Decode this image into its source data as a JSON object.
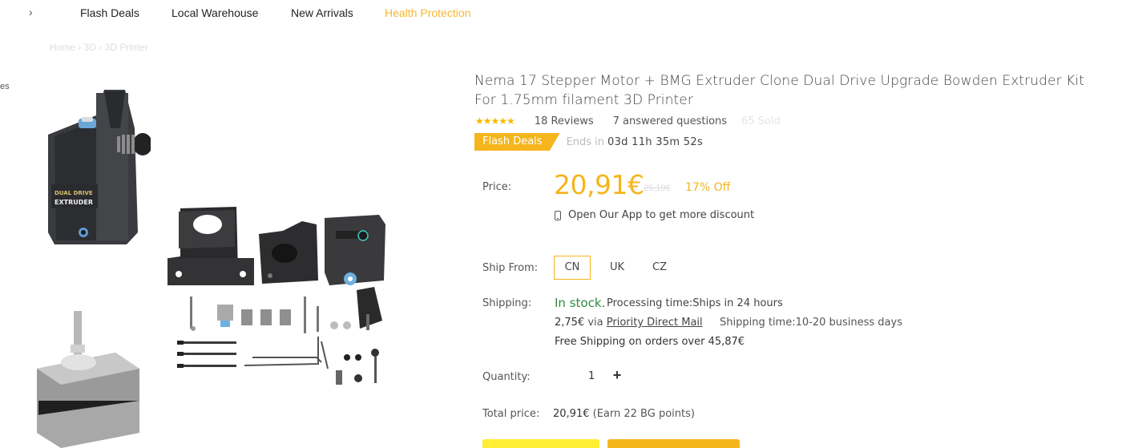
{
  "nav": {
    "chevron": "›",
    "items": [
      "Flash Deals",
      "Local Warehouse",
      "New Arrivals",
      "Health Protection"
    ]
  },
  "breadcrumb": "Home  ›  3D  ›  3D Printer",
  "side_fragment": "es",
  "product": {
    "title": "Nema 17 Stepper Motor + BMG Extruder Clone Dual Drive Upgrade Bowden Extruder Kit For 1.75mm filament 3D Printer",
    "stars": "★★★★★",
    "rating": 5,
    "reviews": "18 Reviews",
    "questions": "7 answered questions",
    "faded_meta": "65 Sold",
    "image_brand_line1": "DUAL DRIVE",
    "image_brand_line2": "EXTRUDER"
  },
  "flash": {
    "badge": "Flash Deals",
    "ends_label": "Ends in",
    "countdown": "03d 11h 35m 52s"
  },
  "price": {
    "label": "Price:",
    "current": "20,91€",
    "original": "25,19€",
    "discount": "17% Off",
    "app_promo": "Open Our App to get more discount"
  },
  "ship_from": {
    "label": "Ship From:",
    "options": [
      "CN",
      "UK",
      "CZ"
    ],
    "selected": "CN"
  },
  "shipping": {
    "label": "Shipping:",
    "stock": "In stock.",
    "processing": "Processing time:Ships in 24 hours",
    "cost": "2,75€",
    "via": "via",
    "method": "Priority Direct Mail",
    "ship_time": "Shipping time:10-20 business days",
    "free": "Free Shipping on orders over 45,87€"
  },
  "quantity": {
    "label": "Quantity:",
    "value": "1",
    "plus": "+"
  },
  "total": {
    "label": "Total price:",
    "value": "20,91€",
    "earn": "(Earn 22 BG points)"
  },
  "colors": {
    "accent": "#f5b51c",
    "cart_button": "#ffee33",
    "in_stock": "#2d8a3f",
    "nav_highlight": "#f7b731"
  }
}
